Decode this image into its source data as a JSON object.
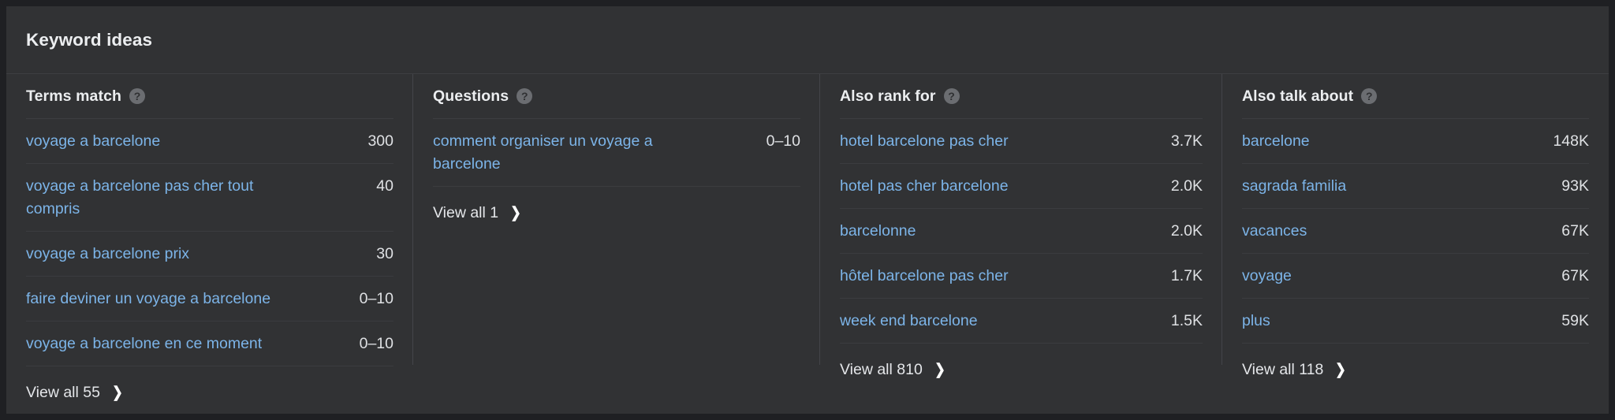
{
  "panel": {
    "title": "Keyword ideas",
    "help_icon": "question-mark-circle-icon",
    "chevron": "❯",
    "colors": {
      "panel_bg": "#313234",
      "outer_bg": "#1f2023",
      "link": "#7cb4e8",
      "text": "#eceef0",
      "divider": "#3d3e41"
    }
  },
  "columns": [
    {
      "header": "Terms match",
      "rows": [
        {
          "keyword": "voyage a barcelone",
          "volume": "300"
        },
        {
          "keyword": "voyage a barcelone pas cher tout compris",
          "volume": "40"
        },
        {
          "keyword": "voyage a barcelone prix",
          "volume": "30"
        },
        {
          "keyword": "faire deviner un voyage a barcelone",
          "volume": "0–10"
        },
        {
          "keyword": "voyage a barcelone en ce moment",
          "volume": "0–10"
        }
      ],
      "view_all": "View all 55"
    },
    {
      "header": "Questions",
      "rows": [
        {
          "keyword": "comment organiser un voyage a barcelone",
          "volume": "0–10"
        }
      ],
      "view_all": "View all 1"
    },
    {
      "header": "Also rank for",
      "rows": [
        {
          "keyword": "hotel barcelone pas cher",
          "volume": "3.7K"
        },
        {
          "keyword": "hotel pas cher barcelone",
          "volume": "2.0K"
        },
        {
          "keyword": "barcelonne",
          "volume": "2.0K"
        },
        {
          "keyword": "hôtel barcelone pas cher",
          "volume": "1.7K"
        },
        {
          "keyword": "week end barcelone",
          "volume": "1.5K"
        }
      ],
      "view_all": "View all 810"
    },
    {
      "header": "Also talk about",
      "rows": [
        {
          "keyword": "barcelone",
          "volume": "148K"
        },
        {
          "keyword": "sagrada familia",
          "volume": "93K"
        },
        {
          "keyword": "vacances",
          "volume": "67K"
        },
        {
          "keyword": "voyage",
          "volume": "67K"
        },
        {
          "keyword": "plus",
          "volume": "59K"
        }
      ],
      "view_all": "View all 118"
    }
  ]
}
